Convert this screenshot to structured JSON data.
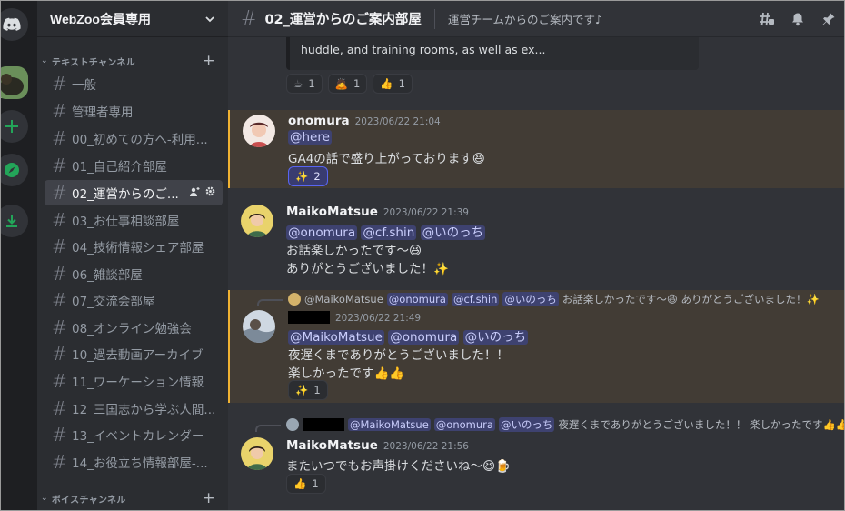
{
  "sidebar": {
    "guild_name": "WebZoo会員専用",
    "text_category": "テキストチャンネル",
    "voice_category": "ボイスチャンネル",
    "channels": [
      {
        "name": "一般"
      },
      {
        "name": "管理者専用"
      },
      {
        "name": "00_初めての方へ-利用..."
      },
      {
        "name": "01_自己紹介部屋"
      },
      {
        "name": "02_運営からのご..."
      },
      {
        "name": "03_お仕事相談部屋"
      },
      {
        "name": "04_技術情報シェア部屋"
      },
      {
        "name": "06_雑談部屋"
      },
      {
        "name": "07_交流会部屋"
      },
      {
        "name": "08_オンライン勉強会"
      },
      {
        "name": "10_過去動画アーカイブ"
      },
      {
        "name": "11_ワーケーション情報"
      },
      {
        "name": "12_三国志から学ぶ人間..."
      },
      {
        "name": "13_イベントカレンダー"
      },
      {
        "name": "14_お役立ち情報部屋-..."
      }
    ]
  },
  "header": {
    "channel_title": "02_運営からのご案内部屋",
    "topic": "運営チームからのご案内です♪"
  },
  "messages": {
    "embed_text": "huddle, and training rooms, as well as ex...",
    "top_reactions": [
      {
        "emoji": "☕",
        "count": "1"
      },
      {
        "emoji": "🙇",
        "count": "1"
      },
      {
        "emoji": "👍",
        "count": "1"
      }
    ],
    "m1": {
      "user": "onomura",
      "time": "2023/06/22 21:04",
      "mention": "@here",
      "text": "GA4の話で盛り上がっております😆",
      "reaction": "✨",
      "reaction_count": "2"
    },
    "m2": {
      "user": "MaikoMatsue",
      "time": "2023/06/22 21:39",
      "mentions": [
        "@onomura",
        "@cf.shin",
        "@いのっち"
      ],
      "line1": "お話楽しかったです〜😆",
      "line2": "ありがとうございました！✨"
    },
    "m3": {
      "reply_user": "@MaikoMatsue",
      "reply_mentions": [
        "@onomura",
        "@cf.shin",
        "@いのっち"
      ],
      "reply_text": "お話楽しかったです〜😆 ありがとうございました！✨",
      "time": "2023/06/22 21:49",
      "mentions": [
        "@MaikoMatsue",
        "@onomura",
        "@いのっち"
      ],
      "line1": "夜遅くまでありがとうございました！！",
      "line2": "楽しかったです👍👍",
      "reaction": "✨",
      "reaction_count": "1"
    },
    "m4": {
      "reply_mentions": [
        "@MaikoMatsue",
        "@onomura",
        "@いのっち"
      ],
      "reply_text": "夜遅くまでありがとうございました！！ 楽しかったです👍👍",
      "user": "MaikoMatsue",
      "time": "2023/06/22 21:56",
      "text": "またいつでもお声掛けくださいね〜😆🍺",
      "reaction": "👍",
      "reaction_count": "1"
    }
  },
  "colors": {
    "accent": "#5865f2",
    "mention_highlight": "#f0b232",
    "green": "#23a559"
  }
}
